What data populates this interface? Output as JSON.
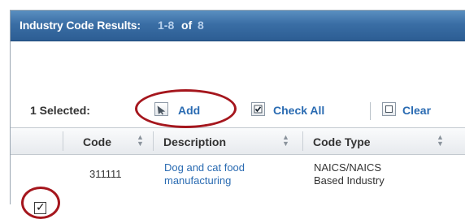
{
  "header": {
    "title": "Industry Code Results:",
    "range": "1-8",
    "of_label": "of",
    "total": "8"
  },
  "toolbar": {
    "selected_text": "1 Selected:",
    "add_label": "Add",
    "check_all_label": "Check All",
    "clear_label": "Clear"
  },
  "table": {
    "columns": [
      "Code",
      "Description",
      "Code Type"
    ],
    "rows": [
      {
        "checked": true,
        "code": "311111",
        "description_line1": "Dog and cat food",
        "description_line2": "manufacturing",
        "code_type_line1": "NAICS/NAICS",
        "code_type_line2": "Based Industry"
      }
    ]
  },
  "icons": {
    "add": "arrow-cursor-icon",
    "check_all": "checked-box-icon",
    "clear": "empty-box-icon",
    "sort": "sort-updown-icon"
  },
  "colors": {
    "header_bg": "#3a6ea5",
    "link": "#2a6bb2",
    "highlight_oval": "#a5161d"
  }
}
